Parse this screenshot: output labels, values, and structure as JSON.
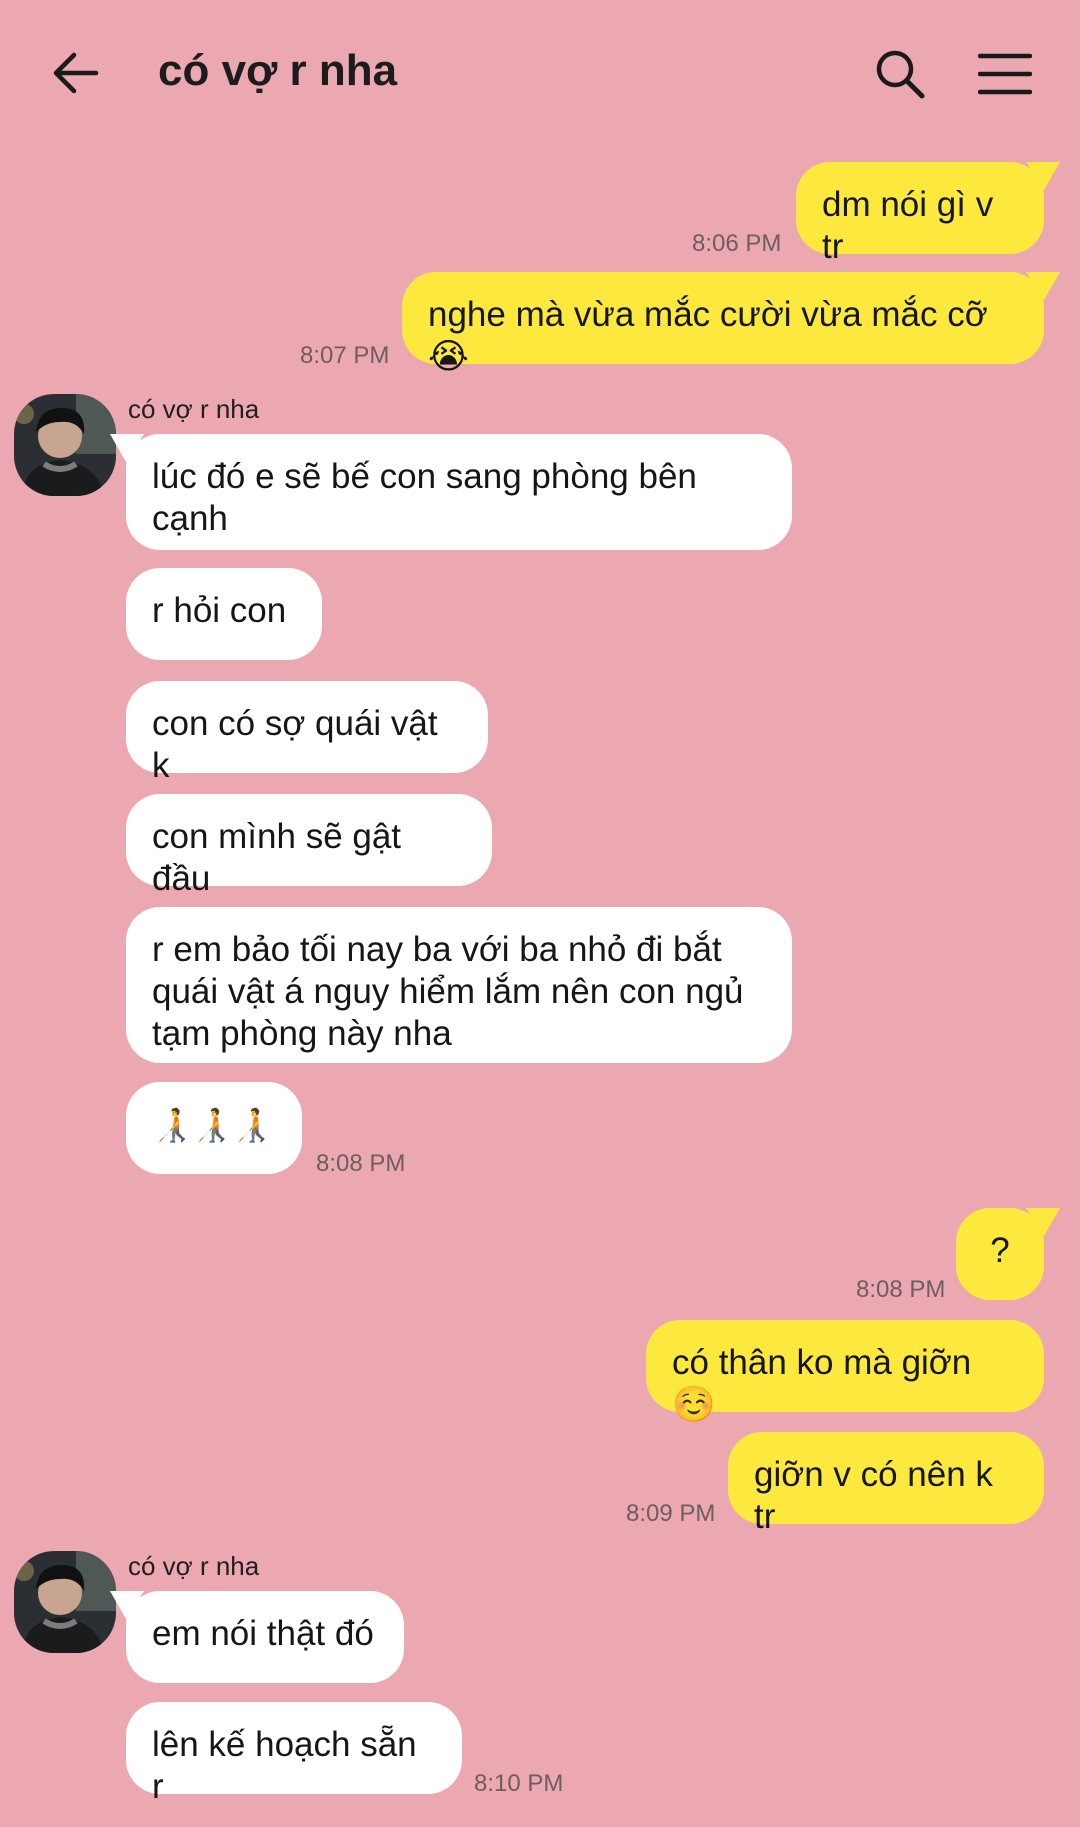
{
  "header": {
    "title": "có vợ r nha",
    "back_icon": "arrow-left-icon",
    "search_icon": "search-icon",
    "menu_icon": "hamburger-menu-icon"
  },
  "colors": {
    "background": "#eba8b1",
    "outgoing_bubble": "#fde93d",
    "incoming_bubble": "#ffffff"
  },
  "messages": [
    {
      "text": "dm nói gì v tr",
      "time": "8:06 PM"
    },
    {
      "text": "nghe mà vừa mắc cười vừa mắc cỡ 😭",
      "time": "8:07 PM"
    },
    {
      "sender": "có vợ r nha",
      "avatar": "person-avatar"
    },
    {
      "text": "lúc đó e sẽ bế con sang phòng bên cạnh"
    },
    {
      "text": "r hỏi con"
    },
    {
      "text": "con có sợ quái vật k"
    },
    {
      "text": "con mình sẽ gật đầu"
    },
    {
      "text": "r em bảo tối nay ba với ba nhỏ đi bắt quái vật á nguy hiểm lắm nên con ngủ tạm phòng này nha"
    },
    {
      "text": "🧑‍🦯🧑‍🦯🧑‍🦯",
      "time": "8:08 PM"
    },
    {
      "text": "?",
      "time": "8:08 PM"
    },
    {
      "text": "có thân ko mà giỡn ☺️"
    },
    {
      "text": "giỡn v có nên k tr",
      "time": "8:09 PM"
    },
    {
      "sender": "có vợ r nha",
      "avatar": "person-avatar"
    },
    {
      "text": "em nói thật đó"
    },
    {
      "text": "lên kế hoạch sẵn r",
      "time": "8:10 PM"
    }
  ]
}
